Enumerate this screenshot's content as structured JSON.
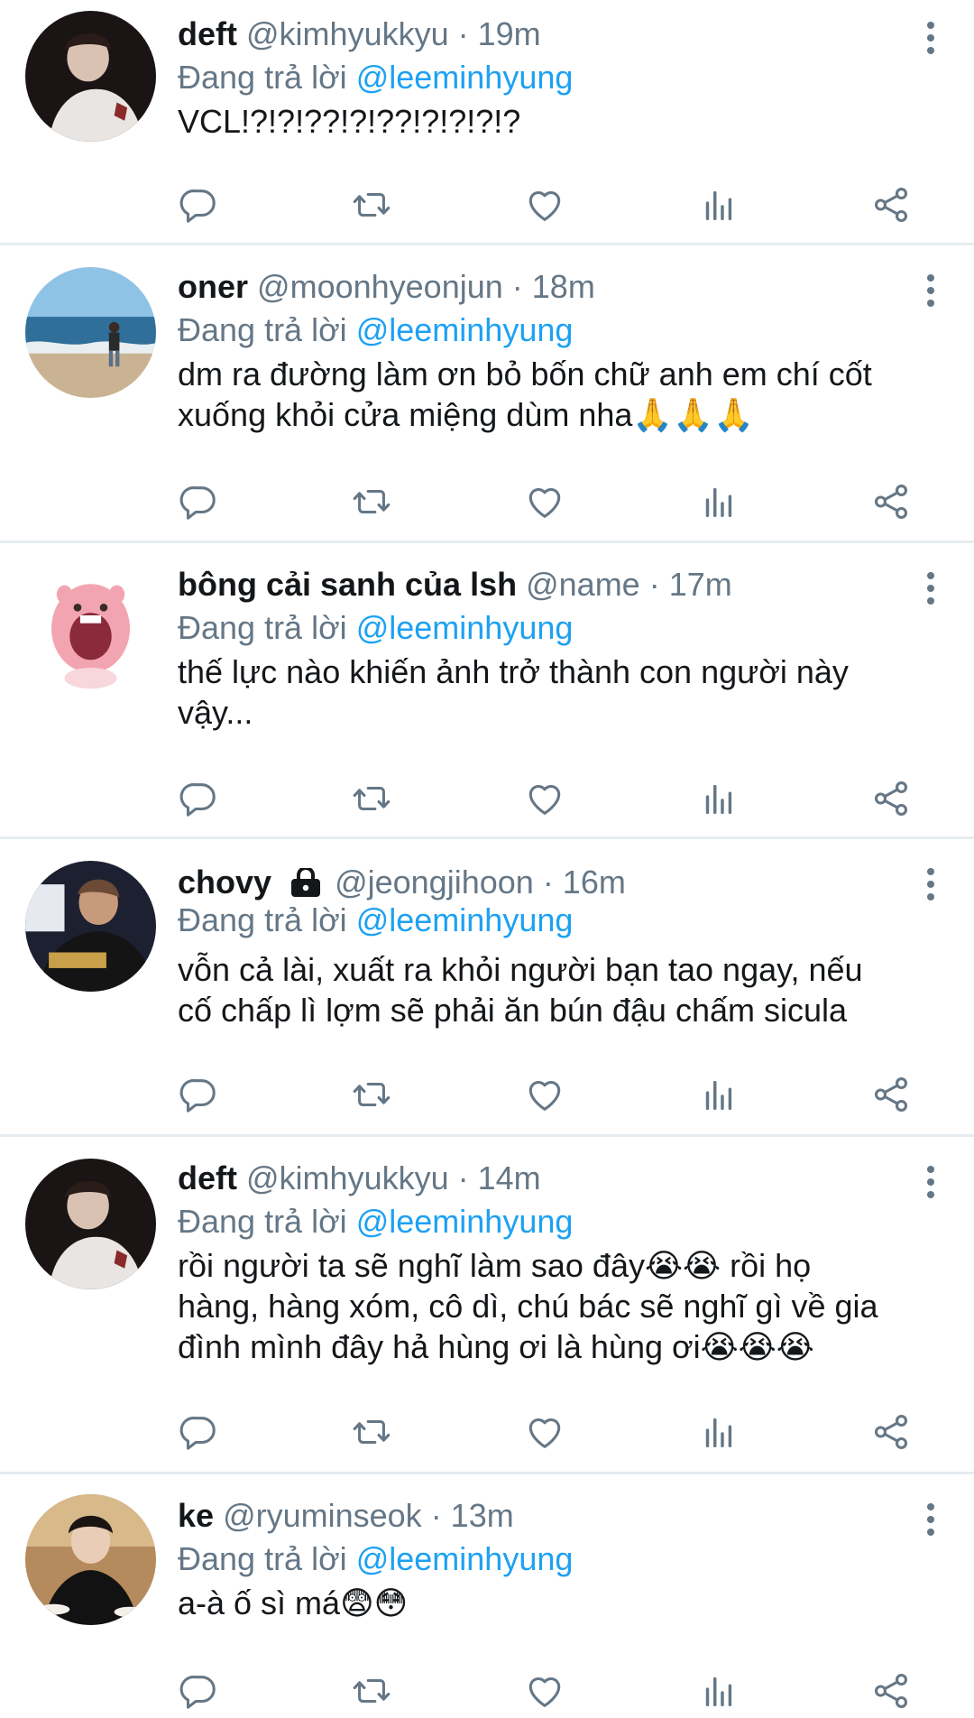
{
  "colors": {
    "link": "#1da1f2",
    "secondary_text": "#657786",
    "primary_text": "#14171a",
    "divider": "#e6ecf0"
  },
  "reply_prefix": "Đang trả lời",
  "tweets": [
    {
      "display_name": "deft",
      "handle": "@kimhyukkyu",
      "time": "· 19m",
      "replying_to": "@leeminhyung",
      "text": "VCL!?!?!??!?!??!?!?!?!?",
      "avatar_icon": "person-black-background-avatar"
    },
    {
      "display_name": "oner",
      "handle": "@moonhyeonjun",
      "time": "· 18m",
      "replying_to": "@leeminhyung",
      "text": "dm ra đường làm ơn bỏ bốn chữ anh em chí cốt xuống khỏi cửa miệng dùm nha🙏🙏🙏",
      "avatar_icon": "beach-avatar"
    },
    {
      "display_name": "bông cải sanh của lsh",
      "handle": "@name",
      "time": "· 17m",
      "replying_to": "@leeminhyung",
      "text": "thế lực nào khiến ảnh trở thành con người này vậy...",
      "avatar_icon": "pink-cartoon-avatar"
    },
    {
      "display_name": "chovy",
      "handle": "@jeongjihoon",
      "time": "· 16m",
      "replying_to": "@leeminhyung",
      "text": "vỗn cả lài, xuất ra khỏi người bạn tao ngay, nếu cố chấp lì lợm sẽ phải ăn bún đậu chấm sicula",
      "avatar_icon": "gen-g-jersey-avatar",
      "protected": true
    },
    {
      "display_name": "deft",
      "handle": "@kimhyukkyu",
      "time": "· 14m",
      "replying_to": "@leeminhyung",
      "text": "rồi người ta sẽ nghĩ làm sao đây😭😭 rồi họ hàng, hàng xóm, cô dì, chú bác sẽ nghĩ gì về gia đình mình đây hả hùng ơi là hùng ơi😭😭😭",
      "avatar_icon": "person-black-background-avatar"
    },
    {
      "display_name": "ke",
      "handle": "@ryuminseok",
      "time": "· 13m",
      "replying_to": "@leeminhyung",
      "text": "a-à ố sì má😨😳",
      "avatar_icon": "restaurant-photo-avatar"
    }
  ],
  "action_icons": [
    "reply-icon",
    "retweet-icon",
    "like-icon",
    "analytics-icon",
    "share-icon"
  ]
}
